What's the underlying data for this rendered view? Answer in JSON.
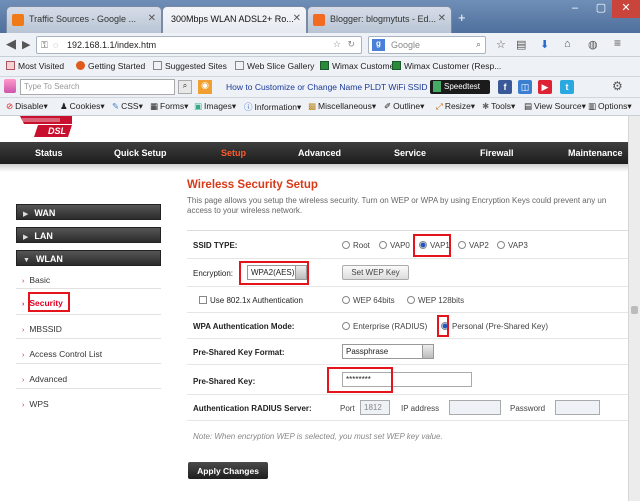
{
  "browser": {
    "tabs": [
      {
        "label": "Traffic Sources - Google ...",
        "icon_color": "#f07a16"
      },
      {
        "label": "300Mbps WLAN ADSL2+ Ro...",
        "icon_color": "#cccccc"
      },
      {
        "label": "Blogger: blogmytuts - Ed...",
        "icon_color": "#f26b21"
      }
    ],
    "url": "192.168.1.1/index.htm",
    "search_placeholder": "Google"
  },
  "bookmarks": [
    "Most Visited",
    "Getting Started",
    "Suggested Sites",
    "Web Slice Gallery",
    "Wimax Customer",
    "Wimax Customer (Resp..."
  ],
  "toolbar2": {
    "search_placeholder": "Type To Search",
    "link": "How to Customize or Change Name PLDT WiFi SSID",
    "speedtest": "Speedtest"
  },
  "devbar": [
    "Disable",
    "Cookies",
    "CSS",
    "Forms",
    "Images",
    "Information",
    "Miscellaneous",
    "Outline",
    "Resize",
    "Tools",
    "View Source",
    "Options"
  ],
  "router": {
    "logo_text": "DSL",
    "menu": [
      "Status",
      "Quick Setup",
      "Setup",
      "Advanced",
      "Service",
      "Firewall",
      "Maintenance"
    ],
    "sidebar": {
      "heads": [
        "WAN",
        "LAN",
        "WLAN"
      ],
      "items": [
        "Basic",
        "Security",
        "MBSSID",
        "Access Control List",
        "Advanced",
        "WPS"
      ]
    },
    "title": "Wireless Security Setup",
    "description_line1": "This page allows you setup the wireless security. Turn on WEP or WPA by using Encryption Keys could prevent any un",
    "description_line2": "access to your wireless network.",
    "form": {
      "ssid_type_label": "SSID TYPE:",
      "ssid_options": [
        "Root",
        "VAP0",
        "VAP1",
        "VAP2",
        "VAP3"
      ],
      "encryption_label": "Encryption:",
      "encryption_value": "WPA2(AES)",
      "set_wep_key": "Set WEP Key",
      "use_8021x": "Use 802.1x Authentication",
      "wep_64": "WEP 64bits",
      "wep_128": "WEP 128bits",
      "wpa_mode_label": "WPA Authentication Mode:",
      "enterprise": "Enterprise (RADIUS)",
      "personal": "Personal (Pre-Shared Key)",
      "psk_format_label": "Pre-Shared Key Format:",
      "psk_format_value": "Passphrase",
      "psk_label": "Pre-Shared Key:",
      "psk_value": "********",
      "radius_label": "Authentication RADIUS Server:",
      "port_label": "Port",
      "port_value": "1812",
      "ip_label": "IP address",
      "password_label": "Password",
      "note": "Note: When encryption WEP is selected, you must set WEP key value.",
      "apply": "Apply Changes"
    }
  }
}
